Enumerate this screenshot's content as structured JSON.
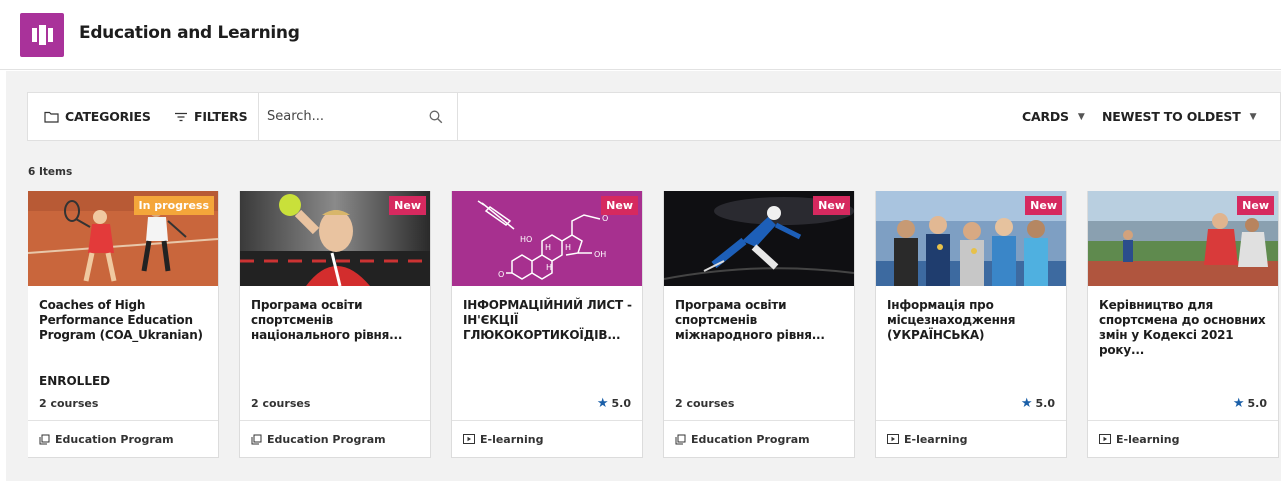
{
  "header": {
    "title": "Education and Learning",
    "logo_icon": "library-books-icon",
    "brand_color": "#a9329a"
  },
  "toolbar": {
    "categories_label": "CATEGORIES",
    "filters_label": "FILTERS",
    "search_placeholder": "Search...",
    "view_label": "CARDS",
    "sort_label": "NEWEST TO OLDEST"
  },
  "list": {
    "count_label": "6 Items"
  },
  "cards": [
    {
      "badge": "In progress",
      "title": "Coaches of High Performance Education Program (COA_Ukranian)",
      "status": "ENROLLED",
      "meta": "2 courses",
      "rating": "",
      "type": "Education Program",
      "image": "tennis"
    },
    {
      "badge": "New",
      "title": "Програма освіти спортсменів національного рівня...",
      "status": "",
      "meta": "2 courses",
      "rating": "",
      "type": "Education Program",
      "image": "handball"
    },
    {
      "badge": "New",
      "title": "ІНФОРМАЦІЙНИЙ ЛИСТ - ІН'ЄКЦІЇ ГЛЮКОКОРТИКОЇДІВ...",
      "status": "",
      "meta": "",
      "rating": "5.0",
      "type": "E-learning",
      "image": "molecule"
    },
    {
      "badge": "New",
      "title": "Програма освіти спортсменів міжнародного рівня...",
      "status": "",
      "meta": "2 courses",
      "rating": "",
      "type": "Education Program",
      "image": "skater"
    },
    {
      "badge": "New",
      "title": "Інформація про місцезнаходження (УКРАЇНСЬКА)",
      "status": "",
      "meta": "",
      "rating": "5.0",
      "type": "E-learning",
      "image": "athletes"
    },
    {
      "badge": "New",
      "title": "Керівництво для спортсмена до основних змін у Кодексі 2021 року...",
      "status": "",
      "meta": "",
      "rating": "5.0",
      "type": "E-learning",
      "image": "runners"
    }
  ]
}
